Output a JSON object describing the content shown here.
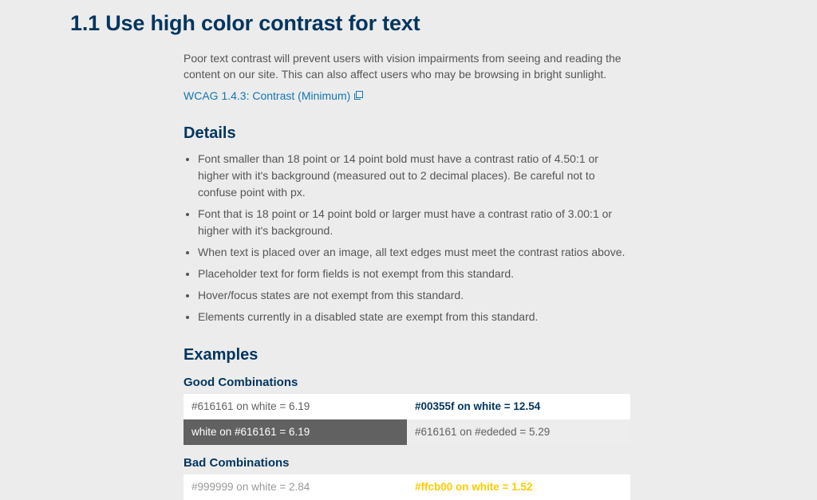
{
  "title": "1.1 Use high color contrast for text",
  "intro": "Poor text contrast will prevent users with vision impairments from seeing and reading the content on our site. This can also affect users who may be browsing in bright sunlight.",
  "wcag_link": "WCAG 1.4.3: Contrast (Minimum)",
  "details_heading": "Details",
  "details": [
    "Font smaller than 18 point or 14 point bold must have a contrast ratio of 4.50:1 or higher with it's background (measured out to 2 decimal places). Be careful not to confuse point with px.",
    "Font that is 18 point or 14 point bold or larger must have a contrast ratio of 3.00:1 or higher with it's background.",
    "When text is placed over an image, all text edges must meet the contrast ratios above.",
    "Placeholder text for form fields is not exempt from this standard.",
    "Hover/focus states are not exempt from this standard.",
    "Elements currently in a disabled state are exempt from this standard."
  ],
  "examples_heading": "Examples",
  "good_heading": "Good Combinations",
  "bad_heading": "Bad Combinations",
  "good": [
    {
      "text": "#616161 on white = 6.19",
      "fg": "#616161",
      "bg": "#ffffff"
    },
    {
      "text": "#00355f on white = 12.54",
      "fg": "#00355f",
      "bg": "#ffffff",
      "bold": true
    },
    {
      "text": "white on #616161 = 6.19",
      "fg": "#ffffff",
      "bg": "#616161"
    },
    {
      "text": "#616161 on #ededed = 5.29",
      "fg": "#616161",
      "bg": "#ededed"
    }
  ],
  "bad": [
    {
      "text": "#999999 on white = 2.84",
      "fg": "#999999",
      "bg": "#ffffff"
    },
    {
      "text": "#ffcb00 on white = 1.52",
      "fg": "#ffcb00",
      "bg": "#ffffff",
      "bold": true
    }
  ]
}
